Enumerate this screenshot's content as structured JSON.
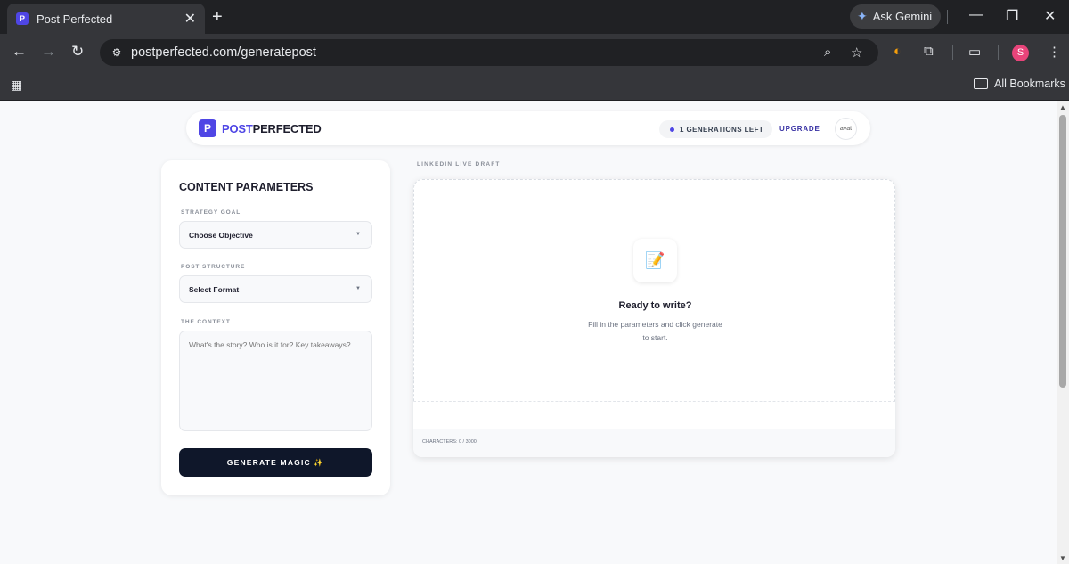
{
  "browser": {
    "tab_title": "Post Perfected",
    "tab_favicon_letter": "P",
    "url": "postperfected.com/generatepost",
    "gemini_label": "Ask Gemini",
    "bookmarks_label": "All Bookmarks",
    "profile_initial": "S",
    "icons": [
      "back-icon",
      "forward-icon",
      "reload-icon",
      "site-info-icon",
      "zoom-icon",
      "star-icon",
      "extension-icon",
      "puzzle-icon",
      "tab-search-icon",
      "menu-icon",
      "apps-icon",
      "folder-icon",
      "minimize-icon",
      "restore-icon",
      "close-icon"
    ]
  },
  "header": {
    "logo_letter": "P",
    "brand_part1": "POST",
    "brand_part2": "PERFECTED",
    "generations_left": "1 GENERATIONS LEFT",
    "upgrade_label": "UPGRADE",
    "avatar_alt": "avat"
  },
  "params": {
    "title": "CONTENT PARAMETERS",
    "strategy_label": "STRATEGY GOAL",
    "strategy_value": "Choose Objective",
    "structure_label": "POST STRUCTURE",
    "structure_value": "Select Format",
    "context_label": "THE CONTEXT",
    "context_placeholder": "What's the story? Who is it for? Key takeaways?",
    "generate_label": "GENERATE MAGIC ✨"
  },
  "draft": {
    "label": "LINKEDIN LIVE DRAFT",
    "icon": "📝",
    "ready_title": "Ready to write?",
    "hint": "Fill in the parameters and click generate to start.",
    "characters": "CHARACTERS: 0 / 3000"
  },
  "colors": {
    "brand": "#4f46e5",
    "button_dark": "#0f172a"
  }
}
